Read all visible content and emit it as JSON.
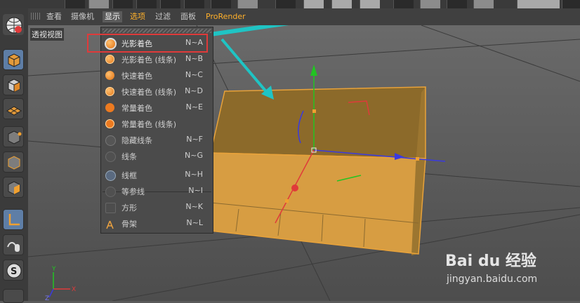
{
  "menubar": {
    "items": [
      {
        "label": "查看"
      },
      {
        "label": "摄像机"
      },
      {
        "label": "显示",
        "active": true
      },
      {
        "label": "选项"
      },
      {
        "label": "过滤"
      },
      {
        "label": "面板"
      },
      {
        "label": "ProRender"
      }
    ]
  },
  "viewport": {
    "title": "透视视图"
  },
  "axes": {
    "x": "X",
    "y": "Y",
    "z": "Z"
  },
  "display_menu": {
    "items": [
      {
        "label": "光影着色",
        "shortcut": "N~A",
        "icon": "shaded-sphere-icon",
        "highlighted": true
      },
      {
        "label": "光影着色 (线条)",
        "shortcut": "N~B",
        "icon": "shaded-lines-sphere-icon"
      },
      {
        "label": "快速着色",
        "shortcut": "N~C",
        "icon": "quick-shade-sphere-icon"
      },
      {
        "label": "快速着色 (线条)",
        "shortcut": "N~D",
        "icon": "quick-shade-lines-sphere-icon"
      },
      {
        "label": "常量着色",
        "shortcut": "N~E",
        "icon": "constant-shade-sphere-icon"
      },
      {
        "label": "常量着色 (线条)",
        "shortcut": "",
        "icon": "constant-shade-lines-sphere-icon"
      },
      {
        "label": "隐藏线条",
        "shortcut": "N~F",
        "icon": "hidden-line-sphere-icon"
      },
      {
        "label": "线条",
        "shortcut": "N~G",
        "icon": "lines-sphere-icon"
      },
      {
        "label": "线框",
        "shortcut": "N~H",
        "icon": "wireframe-sphere-icon"
      },
      {
        "label": "等参线",
        "shortcut": "N~I",
        "icon": "isoparm-sphere-icon"
      },
      {
        "label": "方形",
        "shortcut": "N~K",
        "icon": "box-icon"
      },
      {
        "label": "骨架",
        "shortcut": "N~L",
        "icon": "skeleton-icon"
      }
    ]
  },
  "watermark": {
    "logo": "Bai du 经验",
    "url": "jingyan.baidu.com"
  },
  "colors": {
    "accent_orange": "#ffb02a",
    "highlight_red": "#e03a3a",
    "arrow_teal": "#1fc4c4",
    "object_orange": "#d49a3c"
  }
}
